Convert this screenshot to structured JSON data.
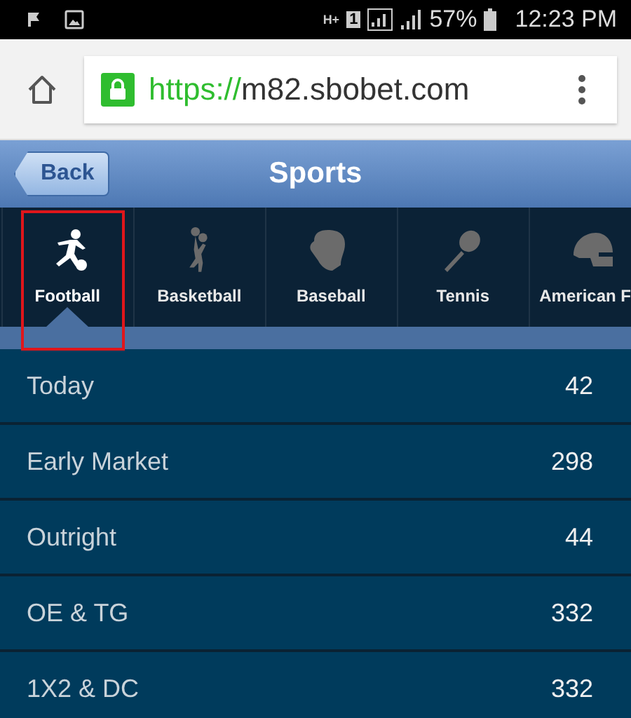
{
  "status_bar": {
    "network": "H+",
    "sim": "1",
    "battery_text": "57%",
    "time": "12:23 PM"
  },
  "browser": {
    "url_scheme": "https://",
    "url_host": "m82.sbobet.com",
    "secure": true
  },
  "header": {
    "back_label": "Back",
    "title": "Sports"
  },
  "sport_tabs": [
    {
      "label": "Football",
      "kind": "football",
      "selected": true,
      "highlighted": true
    },
    {
      "label": "Basketball",
      "kind": "basketball",
      "selected": false,
      "highlighted": false
    },
    {
      "label": "Baseball",
      "kind": "baseball",
      "selected": false,
      "highlighted": false
    },
    {
      "label": "Tennis",
      "kind": "tennis",
      "selected": false,
      "highlighted": false
    },
    {
      "label": "American F",
      "kind": "american-football",
      "selected": false,
      "highlighted": false
    }
  ],
  "markets": [
    {
      "name": "Today",
      "count": "42"
    },
    {
      "name": "Early Market",
      "count": "298"
    },
    {
      "name": "Outright",
      "count": "44"
    },
    {
      "name": "OE & TG",
      "count": "332"
    },
    {
      "name": "1X2 & DC",
      "count": "332"
    }
  ]
}
